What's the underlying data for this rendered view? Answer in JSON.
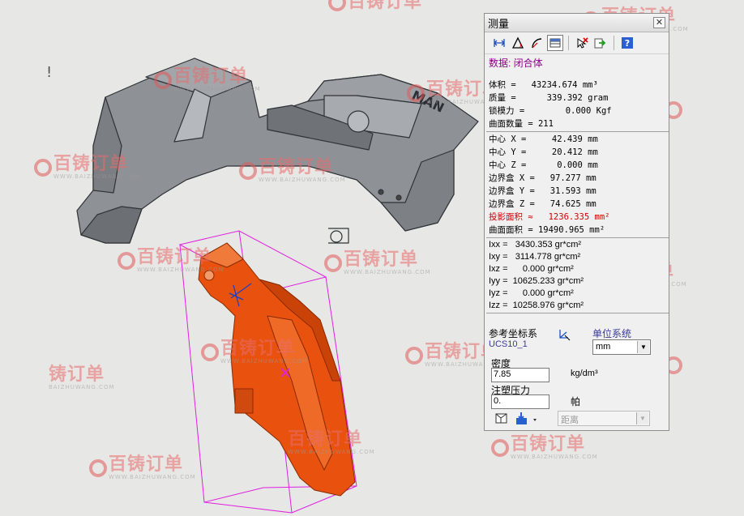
{
  "panel": {
    "title": "测量",
    "data_label": "数据:  闭合体",
    "mass_props": [
      "体积 =   43234.674 mm³",
      "质量 =      339.392 gram",
      "锁模力 =        0.000 Kgf",
      "曲面数量 = 211"
    ],
    "center_box": [
      "中心 X =     42.439 mm",
      "中心 Y =     20.412 mm",
      "中心 Z =      0.000 mm",
      "边界盒 X =   97.277 mm",
      "边界盒 Y =   31.593 mm",
      "边界盒 Z =   74.625 mm"
    ],
    "projected_area": "投影面积 ≈   1236.335 mm²",
    "surface_area": "曲面面积 = 19490.965 mm²",
    "inertia": [
      "Ixx =   3430.353 gr*cm²",
      "Ixy =   3114.778 gr*cm²",
      "Ixz =      0.000 gr*cm²",
      "Iyy =  10625.233 gr*cm²",
      "Iyz =      0.000 gr*cm²",
      "Izz =  10258.976 gr*cm²"
    ],
    "ref_coord_label": "参考坐标系",
    "ref_coord_value": "UCS10_1",
    "unit_system_label": "单位系统",
    "unit_system_value": "mm",
    "density_label": "密度",
    "density_value": "7.85",
    "density_unit": "kg/dm³",
    "injection_label": "注塑压力",
    "injection_value": "0.",
    "injection_unit": "帕",
    "distance_option": "距离"
  },
  "watermark": {
    "brand": "百铸订单",
    "brand_partial": "铸订单",
    "url": "WWW.BAIZHUWANG.COM",
    "url_partial": "BAIZHUWANG.COM"
  },
  "colors": {
    "part_gray": "#8e9196",
    "highlight_orange": "#e8520e",
    "bbox_magenta": "#e020e0",
    "data_purple": "#8b008b",
    "warn_red": "#d00000"
  },
  "icons": [
    "distance-icon",
    "angle-icon",
    "arc-icon",
    "table-icon",
    "clear-selection-icon",
    "export-icon",
    "help-icon",
    "ucs-pick-icon",
    "view-icon",
    "save-dropdown-icon"
  ]
}
